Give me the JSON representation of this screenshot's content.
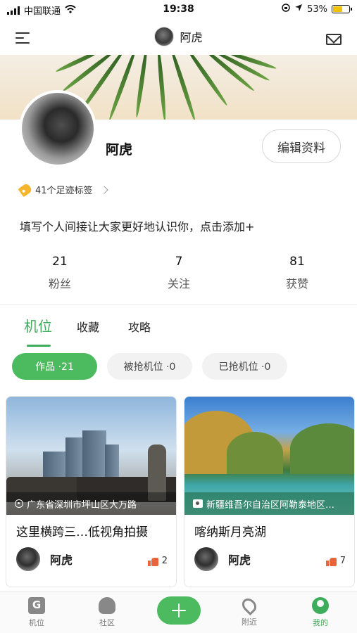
{
  "status_bar": {
    "carrier": "中国联通",
    "time": "19:38",
    "battery": "53%"
  },
  "header": {
    "username": "阿虎"
  },
  "profile": {
    "name": "阿虎",
    "edit_label": "编辑资料",
    "tags_label": "41个足迹标签",
    "bio_placeholder": "填写个人间接让大家更好地认识你，点击添加+"
  },
  "stats": [
    {
      "value": "21",
      "label": "粉丝"
    },
    {
      "value": "7",
      "label": "关注"
    },
    {
      "value": "81",
      "label": "获赞"
    }
  ],
  "tabs": [
    "机位",
    "收藏",
    "攻略"
  ],
  "filters": [
    "作品 ·21",
    "被抢机位 ·0",
    "已抢机位 ·0"
  ],
  "cards": [
    {
      "location": "广东省深圳市坪山区大万路",
      "title": "这里横跨三…低视角拍摄",
      "author": "阿虎",
      "likes": "2"
    },
    {
      "location": "新疆维吾尔自治区阿勒泰地区…",
      "title": "喀纳斯月亮湖",
      "author": "阿虎",
      "likes": "7"
    }
  ],
  "bottom_nav": [
    "机位",
    "社区",
    "附近",
    "我的"
  ],
  "colors": {
    "accent": "#3dac5b",
    "chip_active": "#4cba5f",
    "like": "#e8643c",
    "battery": "#f2c200"
  }
}
